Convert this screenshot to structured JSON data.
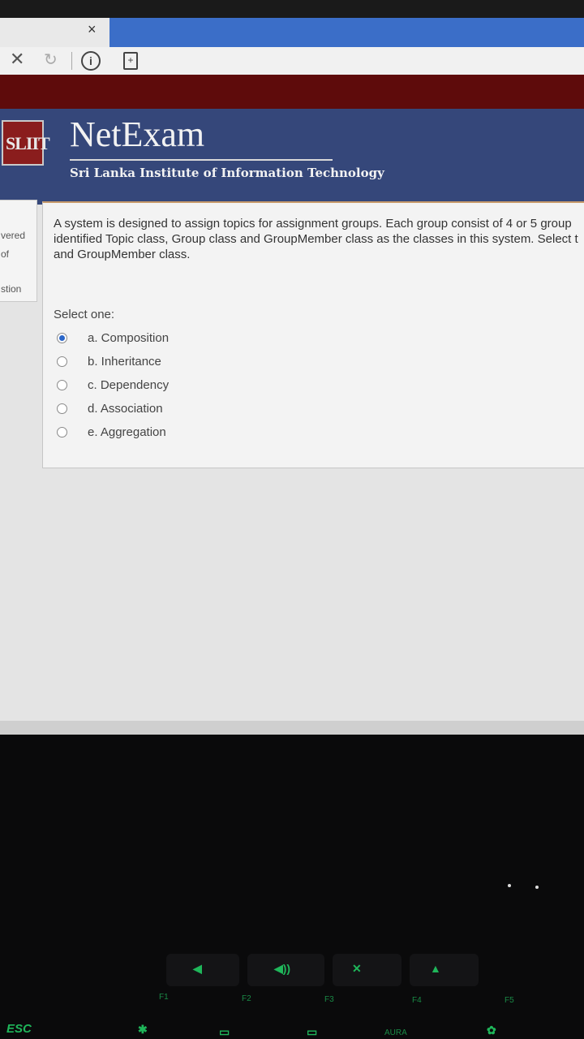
{
  "browser": {
    "tab_close_glyph": "×",
    "stop_glyph": "✕",
    "reload_glyph": "↻",
    "info_glyph": "i",
    "page_glyph": "+"
  },
  "header": {
    "logo_text": "SLIIT",
    "title": "NetExam",
    "subtitle": "Sri Lanka Institute of Information Technology"
  },
  "left_panel": {
    "line1": "vered",
    "line2": "of",
    "line3": "stion"
  },
  "question": {
    "text": "A system is designed to assign topics for assignment groups. Each group consist of 4 or 5 group identified Topic class, Group class and GroupMember class as the classes in this system. Select t and GroupMember class.",
    "prompt": "Select one:",
    "options": [
      {
        "label": "a. Composition",
        "selected": true
      },
      {
        "label": "b. Inheritance",
        "selected": false
      },
      {
        "label": "c. Dependency",
        "selected": false
      },
      {
        "label": "d. Association",
        "selected": false
      },
      {
        "label": "e. Aggregation",
        "selected": false
      }
    ]
  },
  "keyboard": {
    "esc": "ESC",
    "f1": "F1",
    "f2": "F2",
    "f3": "F3",
    "f4": "F4",
    "f5": "F5",
    "aura": "AURA"
  }
}
